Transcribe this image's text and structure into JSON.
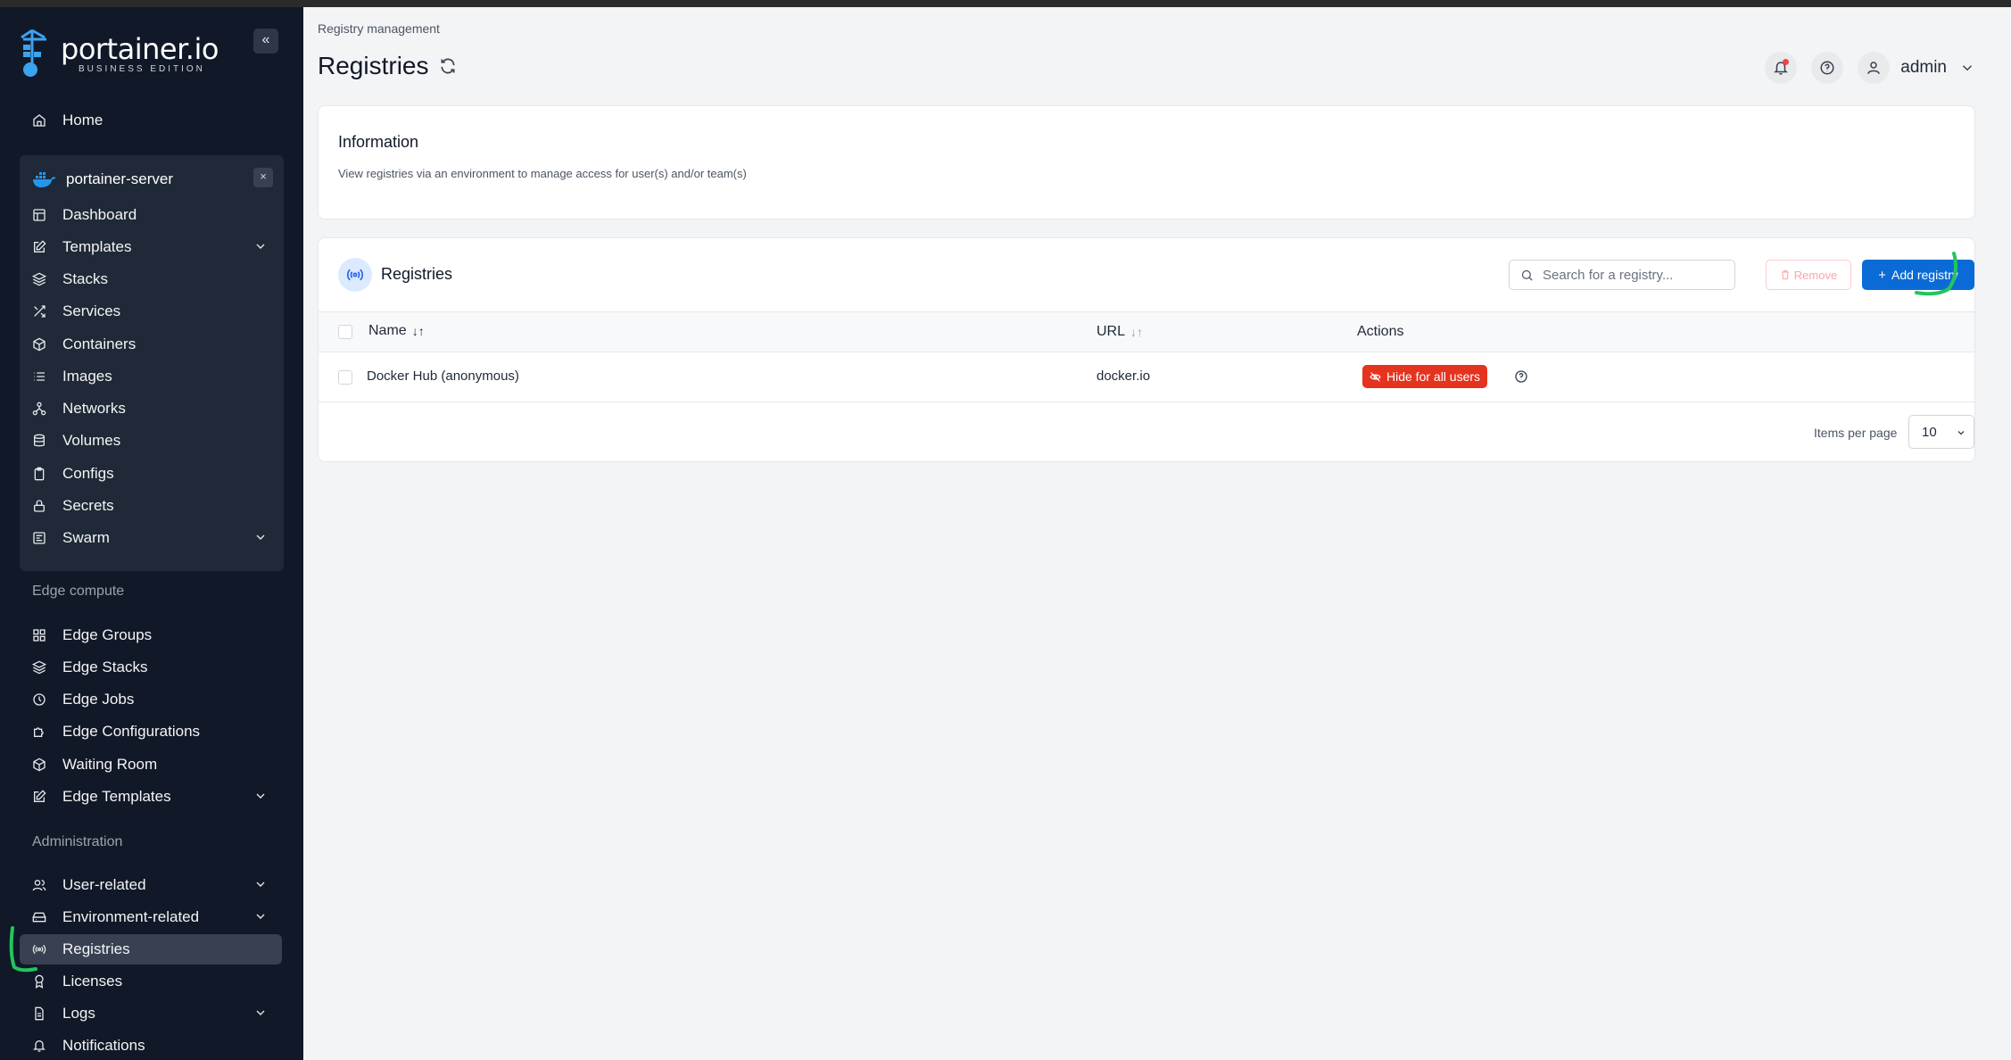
{
  "sidebar": {
    "logo_text": "portainer.io",
    "logo_sub": "BUSINESS EDITION",
    "collapse_glyph": "«",
    "home": "Home",
    "environment": {
      "name": "portainer-server",
      "close_glyph": "×",
      "items": [
        {
          "label": "Dashboard",
          "icon": "dashboard-icon"
        },
        {
          "label": "Templates",
          "icon": "edit-icon",
          "expandable": true
        },
        {
          "label": "Stacks",
          "icon": "layers-icon"
        },
        {
          "label": "Services",
          "icon": "shuffle-icon"
        },
        {
          "label": "Containers",
          "icon": "box-icon"
        },
        {
          "label": "Images",
          "icon": "list-icon"
        },
        {
          "label": "Networks",
          "icon": "network-icon"
        },
        {
          "label": "Volumes",
          "icon": "database-icon"
        },
        {
          "label": "Configs",
          "icon": "clipboard-icon"
        },
        {
          "label": "Secrets",
          "icon": "lock-icon"
        },
        {
          "label": "Swarm",
          "icon": "swarm-icon",
          "expandable": true
        }
      ]
    },
    "edge_section": "Edge compute",
    "edge_items": [
      {
        "label": "Edge Groups",
        "icon": "grid-icon"
      },
      {
        "label": "Edge Stacks",
        "icon": "layers-icon"
      },
      {
        "label": "Edge Jobs",
        "icon": "clock-icon"
      },
      {
        "label": "Edge Configurations",
        "icon": "puzzle-icon"
      },
      {
        "label": "Waiting Room",
        "icon": "box-icon"
      },
      {
        "label": "Edge Templates",
        "icon": "edit-icon",
        "expandable": true
      }
    ],
    "admin_section": "Administration",
    "admin_items": [
      {
        "label": "User-related",
        "icon": "users-icon",
        "expandable": true
      },
      {
        "label": "Environment-related",
        "icon": "hard-drive-icon",
        "expandable": true
      },
      {
        "label": "Registries",
        "icon": "radio-icon",
        "active": true
      },
      {
        "label": "Licenses",
        "icon": "award-icon"
      },
      {
        "label": "Logs",
        "icon": "file-icon",
        "expandable": true
      },
      {
        "label": "Notifications",
        "icon": "bell-icon"
      }
    ]
  },
  "header": {
    "breadcrumb": "Registry management",
    "title": "Registries",
    "user": "admin"
  },
  "info": {
    "title": "Information",
    "text": "View registries via an environment to manage access for user(s) and/or team(s)"
  },
  "registries": {
    "title": "Registries",
    "search_placeholder": "Search for a registry...",
    "remove_label": "Remove",
    "add_label": "Add registry",
    "columns": {
      "name": "Name",
      "url": "URL",
      "actions": "Actions"
    },
    "rows": [
      {
        "name": "Docker Hub (anonymous)",
        "url": "docker.io",
        "action": "Hide for all users"
      }
    ],
    "items_per_page_label": "Items per page",
    "items_per_page": "10"
  },
  "colors": {
    "sidebar_bg": "#111827",
    "accent": "#0b6bd6",
    "danger": "#e4331f",
    "annotation": "#22c55e"
  }
}
